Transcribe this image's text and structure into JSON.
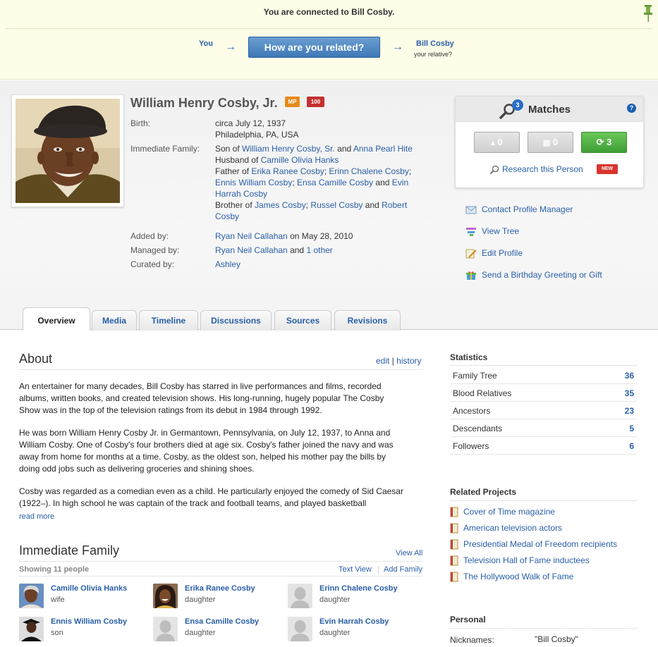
{
  "banner": {
    "connected_text": "You are connected to Bill Cosby.",
    "you_label": "You",
    "relate_button": "How are you related?",
    "relative_name": "Bill Cosby",
    "relative_sub": "your relative?"
  },
  "profile": {
    "name": "William Henry Cosby, Jr.",
    "badge_mp": "MP",
    "badge_score": "100",
    "birth_label": "Birth:",
    "birth_date": "circa July 12, 1937",
    "birth_place": "Philadelphia, PA, USA",
    "family_label": "Immediate Family:",
    "son_of_prefix": "Son of ",
    "father_name": "William Henry Cosby, Sr.",
    "and_word": " and ",
    "mother_name": "Anna Pearl Hite",
    "husband_prefix": "Husband of ",
    "wife_name": "Camille Olivia Hanks",
    "father_of_prefix": "Father of ",
    "children": [
      "Erika Ranee Cosby",
      "Erinn Chalene Cosby",
      "Ennis William Cosby",
      "Ensa Camille Cosby",
      "Evin Harrah Cosby"
    ],
    "brother_prefix": "Brother of ",
    "siblings": [
      "James Cosby",
      "Russel Cosby",
      "Robert Cosby"
    ],
    "added_label": "Added by:",
    "added_by": "Ryan Neil Callahan",
    "added_on": " on May 28, 2010",
    "managed_label": "Managed by:",
    "managed_by": "Ryan Neil Callahan",
    "managed_and": " and ",
    "managed_other": "1 other",
    "curated_label": "Curated by:",
    "curated_by": "Ashley"
  },
  "matches": {
    "title": "Matches",
    "count": "3",
    "help": "?",
    "tree_matches": "0",
    "record_matches": "0",
    "smart_matches": "3",
    "research_link": "Research this Person",
    "new_badge": "NEW"
  },
  "actions": [
    {
      "label": "Contact Profile Manager",
      "icon": "envelope-icon"
    },
    {
      "label": "View Tree",
      "icon": "tree-icon"
    },
    {
      "label": "Edit Profile",
      "icon": "edit-icon"
    },
    {
      "label": "Send a Birthday Greeting or Gift",
      "icon": "gift-icon"
    }
  ],
  "tabs": [
    "Overview",
    "Media",
    "Timeline",
    "Discussions",
    "Sources",
    "Revisions"
  ],
  "about": {
    "title": "About",
    "edit": "edit",
    "divider": "|",
    "history": "history",
    "paragraphs": [
      "An entertainer for many decades, Bill Cosby has starred in live performances and films, recorded albums, written books, and created television shows. His long-running, hugely popular The Cosby Show was in the top of the television ratings from its debut in 1984 through 1992.",
      "He was born William Henry Cosby Jr. in Germantown, Pennsylvania, on July 12, 1937, to Anna and William Cosby. One of Cosby's four brothers died at age six. Cosby's father joined the navy and was away from home for months at a time. Cosby, as the oldest son, helped his mother pay the bills by doing odd jobs such as delivering groceries and shining shoes.",
      "Cosby was regarded as a comedian even as a child. He particularly enjoyed the comedy of Sid Caesar (1922–). In high school he was captain of the track and football teams, and played basketball"
    ],
    "read_more": "read more"
  },
  "family": {
    "title": "Immediate Family",
    "view_all": "View All",
    "showing": "Showing 11 people",
    "text_view": "Text View",
    "add_family": "Add Family",
    "members": [
      {
        "name": "Camille Olivia Hanks",
        "relation": "wife"
      },
      {
        "name": "Erika Ranee Cosby",
        "relation": "daughter"
      },
      {
        "name": "Erinn Chalene Cosby",
        "relation": "daughter"
      },
      {
        "name": "Ennis William Cosby",
        "relation": "son"
      },
      {
        "name": "Ensa Camille Cosby",
        "relation": "daughter"
      },
      {
        "name": "Evin Harrah Cosby",
        "relation": "daughter"
      }
    ]
  },
  "statistics": {
    "title": "Statistics",
    "rows": [
      {
        "label": "Family Tree",
        "value": "36"
      },
      {
        "label": "Blood Relatives",
        "value": "35"
      },
      {
        "label": "Ancestors",
        "value": "23"
      },
      {
        "label": "Descendants",
        "value": "5"
      },
      {
        "label": "Followers",
        "value": "6"
      }
    ]
  },
  "projects": {
    "title": "Related Projects",
    "items": [
      "Cover of Time magazine",
      "American television actors",
      "Presidential Medal of Freedom recipients",
      "Television Hall of Fame inductees",
      "The Hollywood Walk of Fame"
    ]
  },
  "personal": {
    "title": "Personal",
    "nicknames_label": "Nicknames:",
    "nicknames_value": "\"Bill Cosby\""
  }
}
